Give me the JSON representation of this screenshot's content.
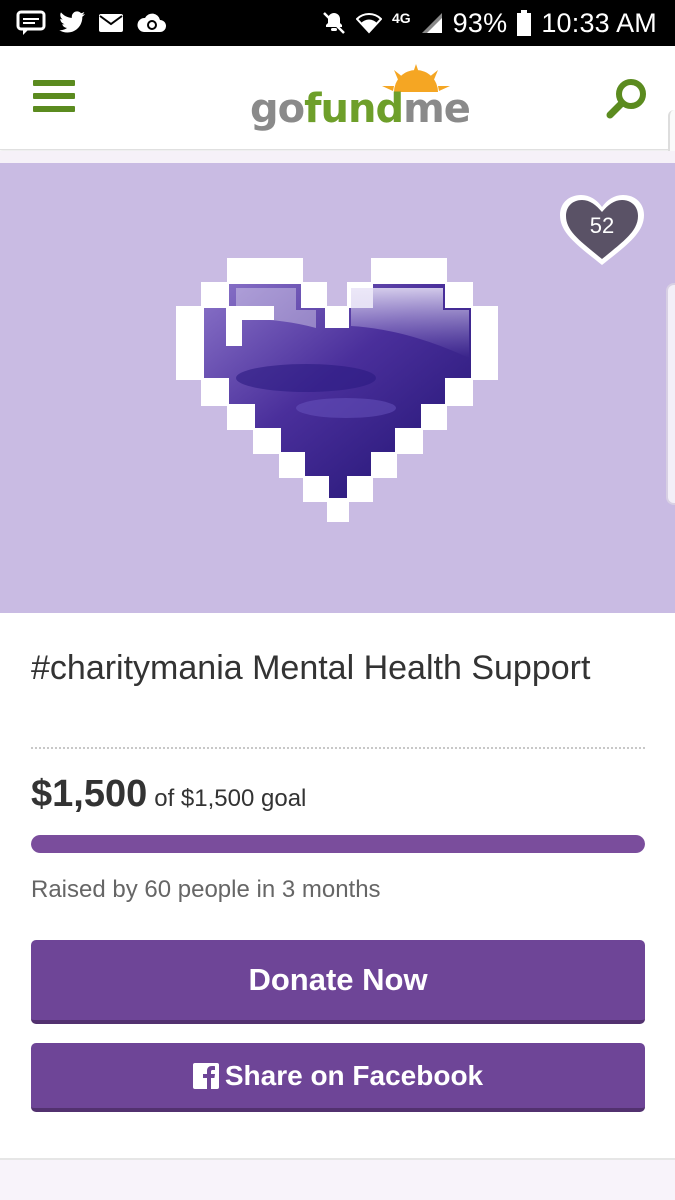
{
  "status_bar": {
    "notifications": [
      "chat-icon",
      "twitter-icon",
      "mail-icon",
      "sync-cloud-icon"
    ],
    "network": "4G",
    "battery": "93%",
    "time": "10:33 AM"
  },
  "header": {
    "logo": {
      "part1": "go",
      "part2": "fund",
      "part3": "me"
    },
    "colors": {
      "brand_green": "#5b8b1f",
      "brand_orange": "#f5a623"
    }
  },
  "hero": {
    "favorites_count": "52",
    "background": "#c9bbe3"
  },
  "campaign": {
    "title": "#charitymania Mental Health Support",
    "raised": "$1,500",
    "goal_text": "of $1,500 goal",
    "progress_fraction": 1.0,
    "raised_by": "Raised by 60 people in 3 months"
  },
  "actions": {
    "donate_label": "Donate Now",
    "share_label": "Share on Facebook"
  },
  "colors": {
    "accent_purple": "#6e4597",
    "progress_purple": "#7a4d9c"
  }
}
